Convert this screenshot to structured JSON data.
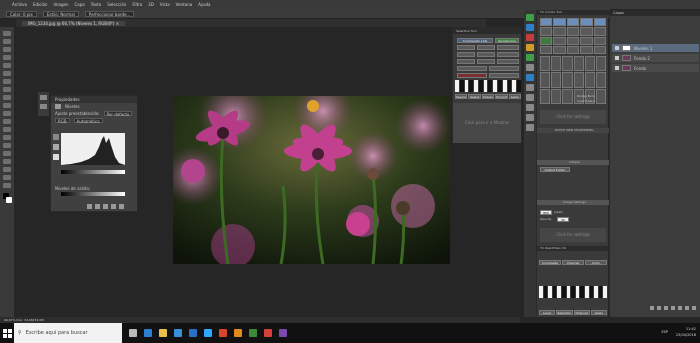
{
  "menu": [
    "Archivo",
    "Edición",
    "Imagen",
    "Capa",
    "Texto",
    "Selección",
    "Filtro",
    "3D",
    "Vista",
    "Ventana",
    "Ayuda"
  ],
  "options": {
    "feather": "Calar: 0 píx",
    "style": "Estilo: Normal",
    "refine": "Perfeccionar borde..."
  },
  "document_tab": "IMG_1234.jpg @ 66,7% (Niveles 1, RGB/8*) ×",
  "properties": {
    "title": "Propiedades",
    "subtitle": "Niveles",
    "preset_label": "Ajuste preestablecido:",
    "preset_value": "Por defecto",
    "channel": "RGB",
    "auto": "Automático",
    "output_label": "Niveles de salida:"
  },
  "middle_panel": {
    "title": "Selection Tool",
    "community": "Community Link",
    "google": "Google Icon",
    "click_here": "Click para ir a Mostrar",
    "bottom_buttons": [
      "Special",
      "Select",
      "Channel",
      "Product",
      "Apply"
    ]
  },
  "right_panel_a": {
    "title": "TK Combo Tool",
    "click_settings": "Click for settings",
    "dodge_burn": "Dodge Burn",
    "color_sharp": "Color Sharp",
    "batch": "BATCH WEB SHARPENING",
    "output": "Output",
    "output_folder": "Output Folder",
    "px_label": "pixels",
    "px_value": "800",
    "opacity": "Opacity",
    "opacity_value": "90",
    "image_settings": "Image Settings",
    "sharpen": "Sharpening",
    "tk_raw": "TK RapidMask V6",
    "composite": "Composite",
    "channel": "Channel",
    "color": "Color",
    "apply": "Apply",
    "tabs": [
      "Layer",
      "Selection",
      "Channel",
      "Apply"
    ]
  },
  "layers": {
    "title": "Capas",
    "items": [
      {
        "name": "Niveles 1"
      },
      {
        "name": "Fondo 2"
      },
      {
        "name": "Fondo"
      }
    ]
  },
  "status": "66,67%   Doc: 34,6M/34,6M",
  "taskbar": {
    "search_placeholder": "Escribe aquí para buscar",
    "time": "11:42",
    "date": "23/04/2018",
    "lang": "ESP"
  }
}
